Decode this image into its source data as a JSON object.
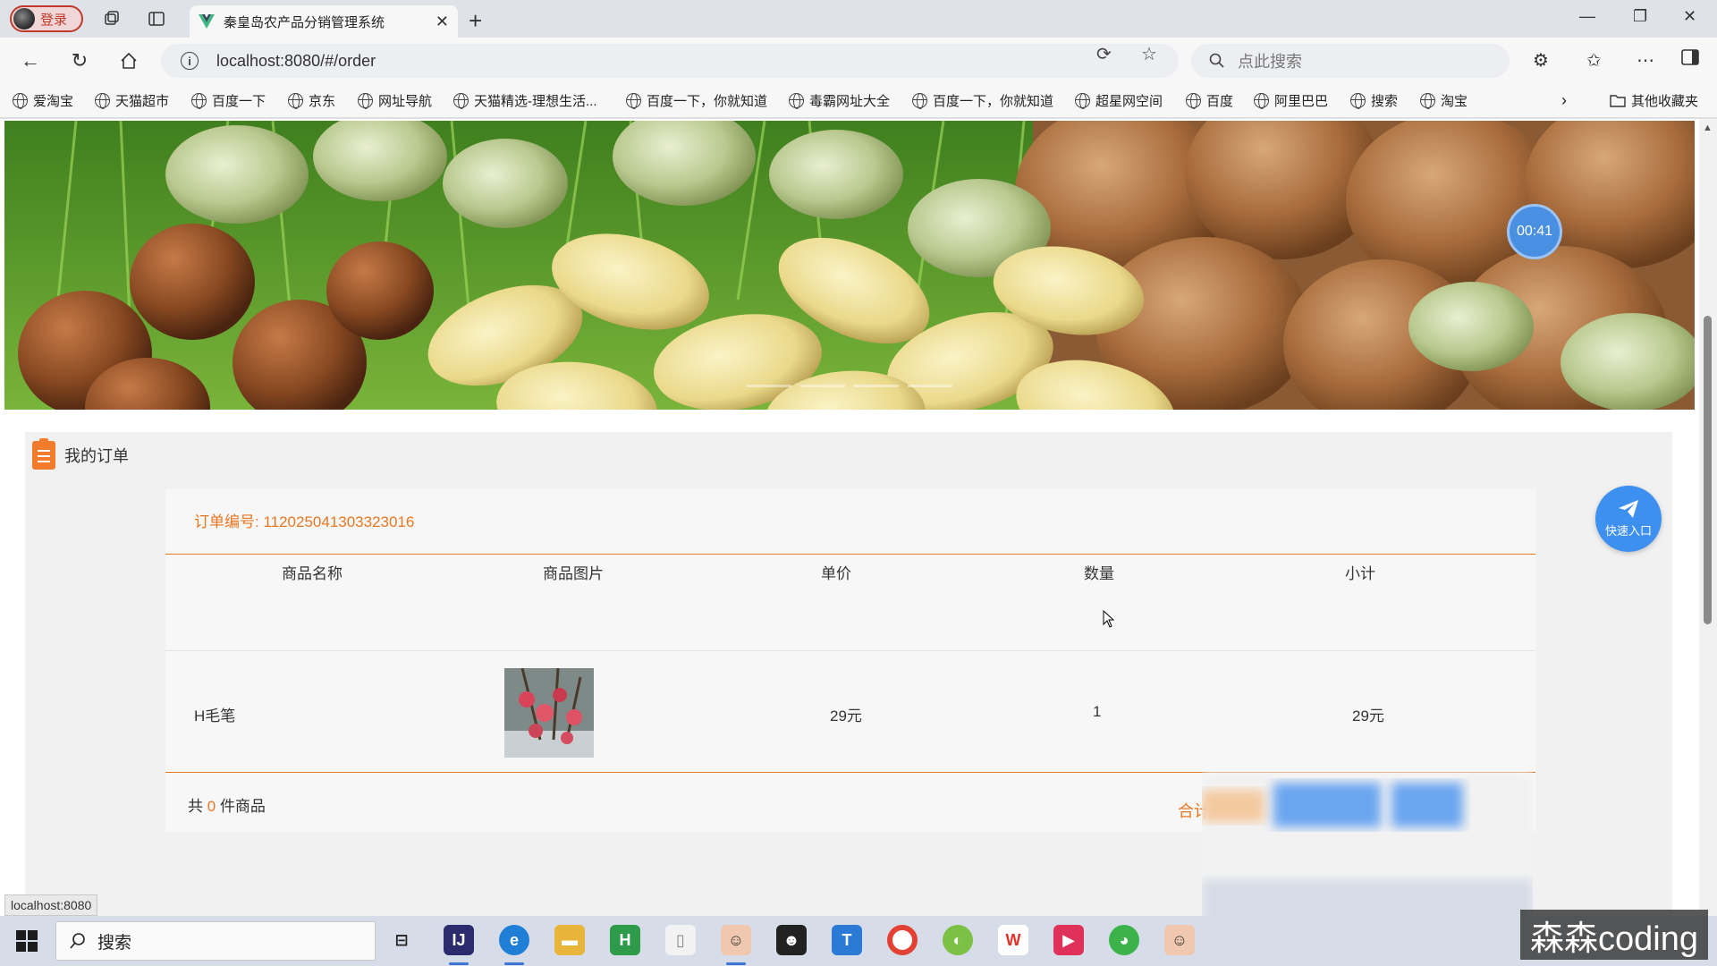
{
  "browser": {
    "profile_label": "登录",
    "tab_title": "秦皇岛农产品分销管理系统",
    "url": "localhost:8080/#/order",
    "search_placeholder": "点此搜索",
    "other_bookmarks": "其他收藏夹",
    "status_url": "localhost:8080"
  },
  "bookmarks": [
    "爱淘宝",
    "天猫超市",
    "百度一下",
    "京东",
    "网址导航",
    "天猫精选-理想生活...",
    "百度一下，你就知道",
    "毒霸网址大全",
    "百度一下，你就知道",
    "超星网空间",
    "百度",
    "阿里巴巴",
    "搜索",
    "淘宝"
  ],
  "page": {
    "timer": "00:41",
    "section_title": "我的订单",
    "quick_entry": "快速入口",
    "order": {
      "order_no": "订单编号: 112025041303323016",
      "columns": [
        "商品名称",
        "商品图片",
        "单价",
        "数量",
        "小计"
      ],
      "items": [
        {
          "name": "H毛笔",
          "price": "29元",
          "quantity": "1",
          "subtotal": "29元"
        }
      ],
      "count_prefix": "共",
      "count_value": "0",
      "count_suffix": "件商品",
      "total_label": "合计:"
    }
  },
  "taskbar": {
    "search_label": "搜索",
    "watermark": "森森coding"
  },
  "colors": {
    "accent_orange": "#e87722",
    "accent_blue": "#3d8ff0"
  }
}
